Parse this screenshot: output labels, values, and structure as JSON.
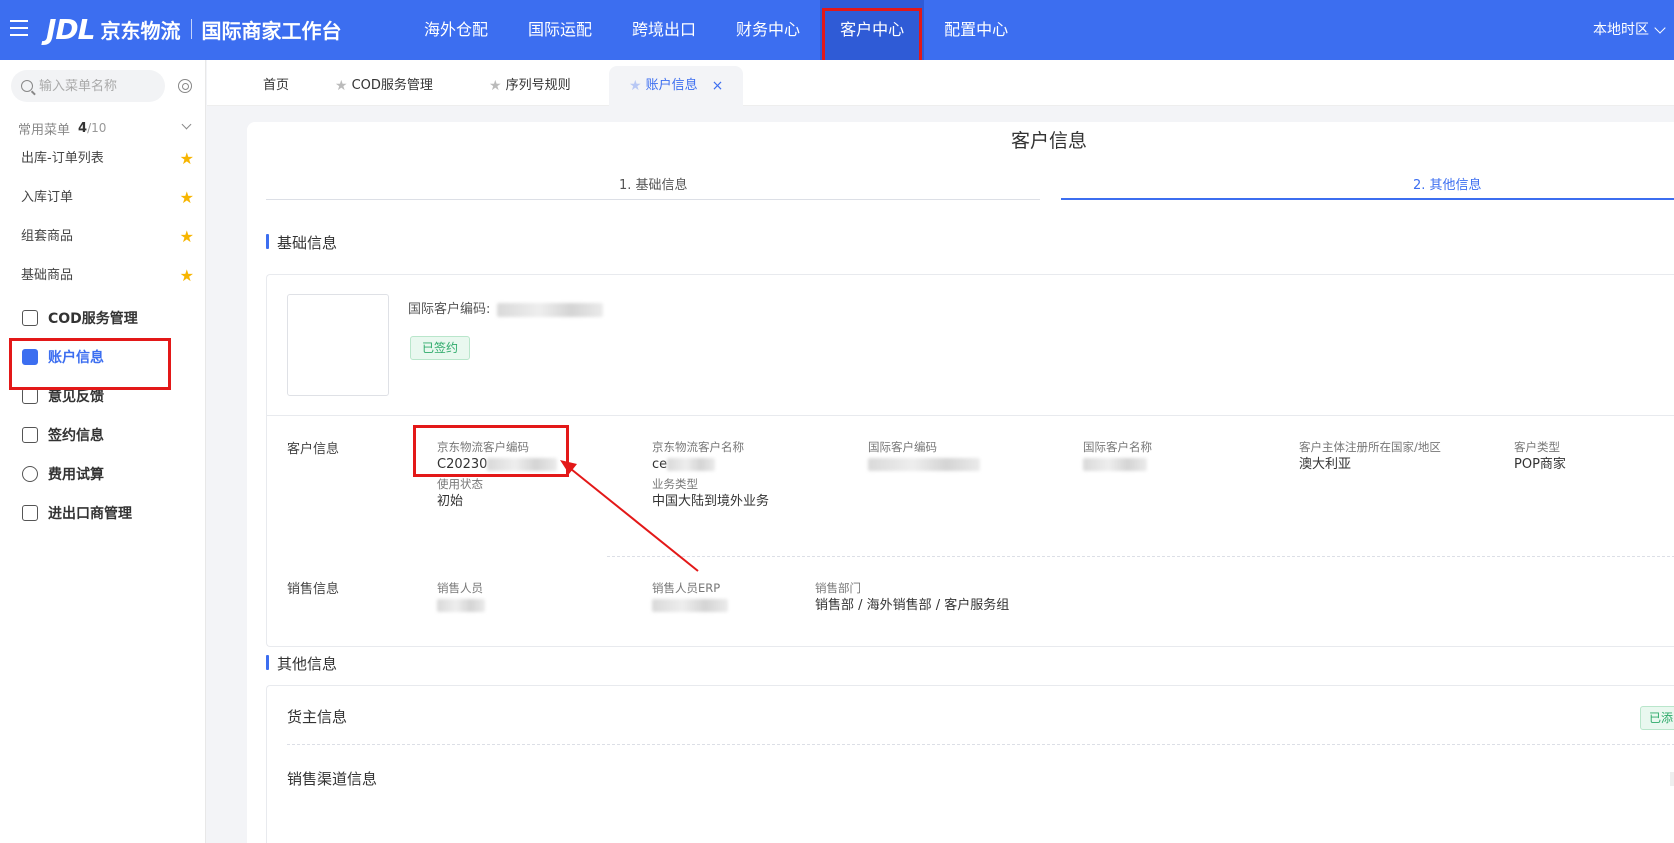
{
  "header": {
    "logo_mark": "JDL",
    "logo_name": "京东物流",
    "logo_sub": "国际商家工作台",
    "nav": [
      "海外仓配",
      "国际运配",
      "跨境出口",
      "财务中心",
      "客户中心",
      "配置中心"
    ],
    "active_nav": "客户中心",
    "timezone": "本地时区",
    "brand_color": "#3c6ef0",
    "highlight_color": "#e31818"
  },
  "sidebar": {
    "search_placeholder": "输入菜单名称",
    "favorites": {
      "title": "常用菜单",
      "count": "4",
      "total": "/10",
      "items": [
        "出库-订单列表",
        "入库订单",
        "组套商品",
        "基础商品"
      ]
    },
    "menu": [
      {
        "label": "COD服务管理",
        "icon": "cod-icon"
      },
      {
        "label": "账户信息",
        "icon": "account-icon",
        "active": true
      },
      {
        "label": "意见反馈",
        "icon": "feedback-icon"
      },
      {
        "label": "签约信息",
        "icon": "contract-icon"
      },
      {
        "label": "费用试算",
        "icon": "fee-calc-icon"
      },
      {
        "label": "进出口商管理",
        "icon": "importer-icon"
      }
    ]
  },
  "tabs": [
    {
      "label": "首页"
    },
    {
      "label": "COD服务管理"
    },
    {
      "label": "序列号规则"
    },
    {
      "label": "账户信息",
      "active": true
    }
  ],
  "page": {
    "title": "客户信息",
    "steps": [
      "1. 基础信息",
      "2. 其他信息"
    ],
    "active_step": 2,
    "section_basic": "基础信息",
    "intl_code_label": "国际客户编码:",
    "signed_badge": "已签约",
    "customer_info": {
      "row_label": "客户信息",
      "fields": [
        {
          "label": "京东物流客户编码",
          "value": "C20230"
        },
        {
          "label": "京东物流客户名称",
          "value": "ce"
        },
        {
          "label": "国际客户编码",
          "value": ""
        },
        {
          "label": "国际客户名称",
          "value": ""
        },
        {
          "label": "客户主体注册所在国家/地区",
          "value": "澳大利亚"
        },
        {
          "label": "客户类型",
          "value": "POP商家"
        },
        {
          "label": "使用状态",
          "value": "初始"
        },
        {
          "label": "业务类型",
          "value": "中国大陆到境外业务"
        }
      ]
    },
    "sales_info": {
      "row_label": "销售信息",
      "fields": [
        {
          "label": "销售人员",
          "value": ""
        },
        {
          "label": "销售人员ERP",
          "value": ""
        },
        {
          "label": "销售部门",
          "value": "销售部 / 海外销售部 / 客户服务组"
        }
      ]
    },
    "section_other": "其他信息",
    "other_rows": [
      "货主信息",
      "销售渠道信息"
    ],
    "other_badge": "已添"
  }
}
